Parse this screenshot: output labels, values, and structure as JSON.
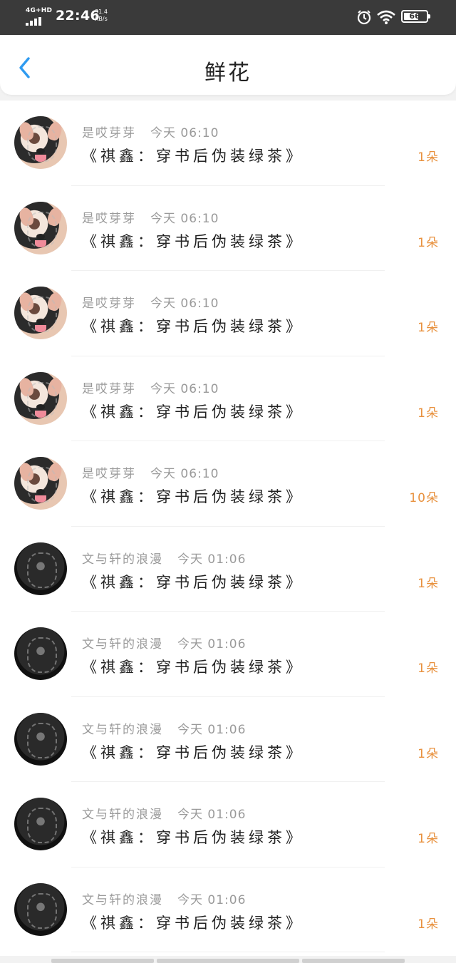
{
  "status_bar": {
    "network": "4G+HD",
    "time": "22:46",
    "speed_value": "31.4",
    "speed_unit": "KB/s",
    "battery": "66",
    "icons": [
      "signal-icon",
      "alarm-icon",
      "wifi-icon",
      "battery-icon"
    ]
  },
  "header": {
    "title": "鲜花",
    "back_icon": "chevron-left-icon",
    "accent_color": "#2f9bf0"
  },
  "colors": {
    "count": "#e8913e",
    "meta": "#9a9a9a",
    "text": "#222222"
  },
  "items": [
    {
      "user": "是哎芽芽",
      "time": "今天 06:10",
      "book": "《祺鑫：穿书后伪装绿茶》",
      "count": "1朵",
      "avatar": "dog-avatar"
    },
    {
      "user": "是哎芽芽",
      "time": "今天 06:10",
      "book": "《祺鑫：穿书后伪装绿茶》",
      "count": "1朵",
      "avatar": "dog-avatar"
    },
    {
      "user": "是哎芽芽",
      "time": "今天 06:10",
      "book": "《祺鑫：穿书后伪装绿茶》",
      "count": "1朵",
      "avatar": "dog-avatar"
    },
    {
      "user": "是哎芽芽",
      "time": "今天 06:10",
      "book": "《祺鑫：穿书后伪装绿茶》",
      "count": "1朵",
      "avatar": "dog-avatar"
    },
    {
      "user": "是哎芽芽",
      "time": "今天 06:10",
      "book": "《祺鑫：穿书后伪装绿茶》",
      "count": "10朵",
      "avatar": "dog-avatar"
    },
    {
      "user": "文与轩的浪漫",
      "time": "今天 01:06",
      "book": "《祺鑫：穿书后伪装绿茶》",
      "count": "1朵",
      "avatar": "dark-avatar"
    },
    {
      "user": "文与轩的浪漫",
      "time": "今天 01:06",
      "book": "《祺鑫：穿书后伪装绿茶》",
      "count": "1朵",
      "avatar": "dark-avatar"
    },
    {
      "user": "文与轩的浪漫",
      "time": "今天 01:06",
      "book": "《祺鑫：穿书后伪装绿茶》",
      "count": "1朵",
      "avatar": "dark-avatar"
    },
    {
      "user": "文与轩的浪漫",
      "time": "今天 01:06",
      "book": "《祺鑫：穿书后伪装绿茶》",
      "count": "1朵",
      "avatar": "dark-avatar"
    },
    {
      "user": "文与轩的浪漫",
      "time": "今天 01:06",
      "book": "《祺鑫：穿书后伪装绿茶》",
      "count": "1朵",
      "avatar": "dark-avatar"
    }
  ]
}
